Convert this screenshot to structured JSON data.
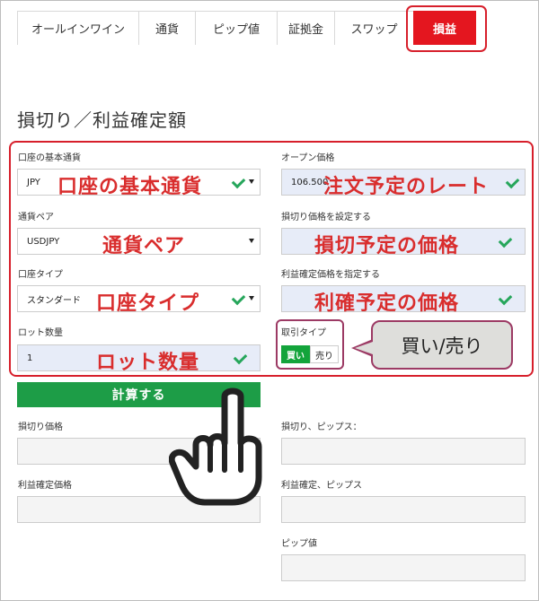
{
  "tabs": [
    {
      "label": "オールインワイン"
    },
    {
      "label": "通貨"
    },
    {
      "label": "ピップ値"
    },
    {
      "label": "証拠金"
    },
    {
      "label": "スワップ"
    },
    {
      "label": "損益",
      "active": true
    }
  ],
  "section_title": "損切り／利益確定額",
  "form": {
    "base_currency": {
      "label": "口座の基本通貨",
      "value": "JPY",
      "overlay": "口座の基本通貨"
    },
    "open_price": {
      "label": "オープン価格",
      "value": "106.500",
      "overlay": "注文予定のレート"
    },
    "pair": {
      "label": "通貨ペア",
      "value": "USDJPY",
      "overlay": "通貨ペア"
    },
    "stop_loss_price": {
      "label": "損切り価格を設定する",
      "overlay": "損切予定の価格"
    },
    "account_type": {
      "label": "口座タイプ",
      "value": "スタンダード",
      "overlay": "口座タイプ"
    },
    "take_profit_price": {
      "label": "利益確定価格を指定する",
      "overlay": "利確予定の価格"
    },
    "lots": {
      "label": "ロット数量",
      "value": "1",
      "overlay": "ロット数量"
    },
    "trade_type": {
      "label": "取引タイプ",
      "buy": "買い",
      "sell": "売り"
    }
  },
  "callout": "買い/売り",
  "calculate_label": "計算する",
  "results": {
    "stop_loss_price": "損切り価格",
    "stop_loss_pips": "損切り、ピップス：",
    "take_profit_price": "利益確定価格",
    "take_profit_pips": "利益確定、ピップス",
    "pip_value": "ピップ値"
  },
  "colors": {
    "active_tab": "#e4161f",
    "highlight": "#d71f2b",
    "annotation_text": "#d92d2d",
    "buy": "#13a43b",
    "calculate": "#1d9d47",
    "check": "#26a65b"
  },
  "icons": [
    "check-icon",
    "chevron-down-icon",
    "pointing-hand-icon"
  ]
}
